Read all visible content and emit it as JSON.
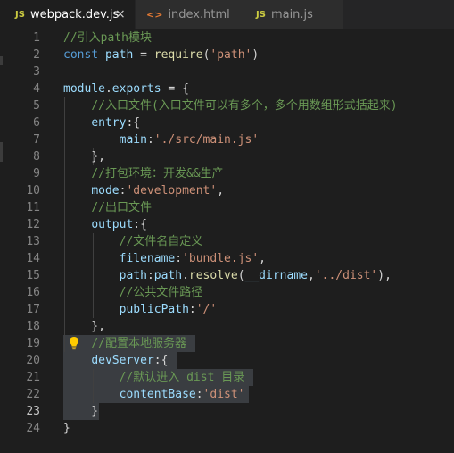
{
  "tabs": [
    {
      "icon": "JS",
      "label": "webpack.dev.js",
      "active": true,
      "close": "×"
    },
    {
      "icon": "<>",
      "label": "index.html",
      "active": false
    },
    {
      "icon": "JS",
      "label": "main.js",
      "active": false
    }
  ],
  "colors": {
    "comment": "#6a9955",
    "keyword": "#569cd6",
    "variable": "#9cdcfe",
    "function": "#dcdcaa",
    "string": "#ce9178",
    "text": "#d4d4d4",
    "background": "#1e1e1e"
  },
  "lines": [
    {
      "n": "1",
      "tokens": [
        [
          "c",
          "//引入path模块"
        ]
      ]
    },
    {
      "n": "2",
      "tokens": [
        [
          "k",
          "const"
        ],
        [
          "p",
          " "
        ],
        [
          "v",
          "path"
        ],
        [
          "p",
          " = "
        ],
        [
          "f",
          "require"
        ],
        [
          "p",
          "("
        ],
        [
          "s",
          "'path'"
        ],
        [
          "p",
          ")"
        ]
      ]
    },
    {
      "n": "3",
      "tokens": []
    },
    {
      "n": "4",
      "tokens": [
        [
          "v",
          "module"
        ],
        [
          "p",
          "."
        ],
        [
          "v",
          "exports"
        ],
        [
          "p",
          " = {"
        ]
      ]
    },
    {
      "n": "5",
      "tokens": [
        [
          "p",
          "    "
        ],
        [
          "c",
          "//入口文件(入口文件可以有多个，多个用数组形式括起来)"
        ]
      ]
    },
    {
      "n": "6",
      "tokens": [
        [
          "p",
          "    "
        ],
        [
          "v",
          "entry"
        ],
        [
          "p",
          ":{"
        ]
      ]
    },
    {
      "n": "7",
      "tokens": [
        [
          "p",
          "        "
        ],
        [
          "v",
          "main"
        ],
        [
          "p",
          ":"
        ],
        [
          "s",
          "'./src/main.js'"
        ]
      ]
    },
    {
      "n": "8",
      "tokens": [
        [
          "p",
          "    },"
        ]
      ]
    },
    {
      "n": "9",
      "tokens": [
        [
          "p",
          "    "
        ],
        [
          "c",
          "//打包环境：开发&&生产"
        ]
      ]
    },
    {
      "n": "10",
      "tokens": [
        [
          "p",
          "    "
        ],
        [
          "v",
          "mode"
        ],
        [
          "p",
          ":"
        ],
        [
          "s",
          "'development'"
        ],
        [
          "p",
          ","
        ]
      ]
    },
    {
      "n": "11",
      "tokens": [
        [
          "p",
          "    "
        ],
        [
          "c",
          "//出口文件"
        ]
      ]
    },
    {
      "n": "12",
      "tokens": [
        [
          "p",
          "    "
        ],
        [
          "v",
          "output"
        ],
        [
          "p",
          ":{"
        ]
      ]
    },
    {
      "n": "13",
      "tokens": [
        [
          "p",
          "        "
        ],
        [
          "c",
          "//文件名自定义"
        ]
      ]
    },
    {
      "n": "14",
      "tokens": [
        [
          "p",
          "        "
        ],
        [
          "v",
          "filename"
        ],
        [
          "p",
          ":"
        ],
        [
          "s",
          "'bundle.js'"
        ],
        [
          "p",
          ","
        ]
      ]
    },
    {
      "n": "15",
      "tokens": [
        [
          "p",
          "        "
        ],
        [
          "v",
          "path"
        ],
        [
          "p",
          ":"
        ],
        [
          "v",
          "path"
        ],
        [
          "p",
          "."
        ],
        [
          "f",
          "resolve"
        ],
        [
          "p",
          "("
        ],
        [
          "v",
          "__dirname"
        ],
        [
          "p",
          ","
        ],
        [
          "s",
          "'../dist'"
        ],
        [
          "p",
          "),"
        ]
      ]
    },
    {
      "n": "16",
      "tokens": [
        [
          "p",
          "        "
        ],
        [
          "c",
          "//公共文件路径"
        ]
      ]
    },
    {
      "n": "17",
      "tokens": [
        [
          "p",
          "        "
        ],
        [
          "v",
          "publicPath"
        ],
        [
          "p",
          ":"
        ],
        [
          "s",
          "'/'"
        ]
      ]
    },
    {
      "n": "18",
      "tokens": [
        [
          "p",
          "    },"
        ]
      ]
    },
    {
      "n": "19",
      "tokens": [
        [
          "p",
          "    "
        ],
        [
          "c",
          "//配置本地服务器"
        ]
      ]
    },
    {
      "n": "20",
      "tokens": [
        [
          "p",
          "    "
        ],
        [
          "v",
          "devServer"
        ],
        [
          "p",
          ":{"
        ]
      ]
    },
    {
      "n": "21",
      "tokens": [
        [
          "p",
          "        "
        ],
        [
          "c",
          "//默认进入 dist 目录"
        ]
      ]
    },
    {
      "n": "22",
      "tokens": [
        [
          "p",
          "        "
        ],
        [
          "v",
          "contentBase"
        ],
        [
          "p",
          ":"
        ],
        [
          "s",
          "'dist'"
        ]
      ]
    },
    {
      "n": "23",
      "tokens": [
        [
          "p",
          "    }"
        ]
      ]
    },
    {
      "n": "24",
      "tokens": [
        [
          "p",
          "}"
        ]
      ]
    }
  ],
  "current_line": "23"
}
